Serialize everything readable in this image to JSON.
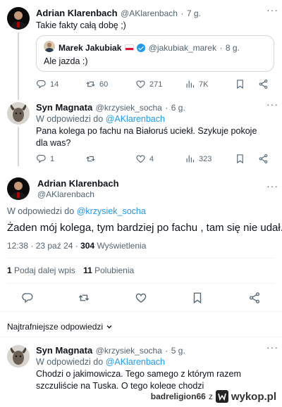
{
  "tweet1": {
    "author_name": "Adrian Klarenbach",
    "author_handle": "@AKlarenbach",
    "separator": "·",
    "time": "7 g.",
    "text": "Takie fakty całą dobę ;)",
    "quote": {
      "author_name": "Marek Jakubiak",
      "author_handle": "@jakubiak_marek",
      "separator": "·",
      "time": "8 g.",
      "text": "Ale jazda :)"
    },
    "metrics": {
      "replies": "14",
      "reposts": "60",
      "likes": "271",
      "views": "7K"
    }
  },
  "tweet2": {
    "author_name": "Syn Magnata",
    "author_handle": "@krzysiek_socha",
    "separator": "·",
    "time": "6 g.",
    "reply_prefix": "W odpowiedzi do",
    "reply_to": "@AKlarenbach",
    "text": "Pana kolega po fachu na Białoruś uciekł. Szykuje pokoje dla was?",
    "metrics": {
      "replies": "1",
      "reposts": "",
      "likes": "4",
      "views": "323"
    }
  },
  "main_tweet": {
    "author_name": "Adrian Klarenbach",
    "author_handle": "@AKlarenbach",
    "reply_prefix": "W odpowiedzi do",
    "reply_to": "@krzysiek_socha",
    "text": "Żaden mój kolega, tym bardziej po fachu , tam się nie udał.",
    "timestamp": "12:38 · 23 paź 24 ·",
    "views_count": "304",
    "views_label": "Wyświetlenia",
    "reposts_count": "1",
    "reposts_label": "Podaj dalej wpis",
    "likes_count": "11",
    "likes_label": "Polubienia"
  },
  "sort": {
    "label": "Najtrafniejsze odpowiedzi"
  },
  "tweet3": {
    "author_name": "Syn Magnata",
    "author_handle": "@krzysiek_socha",
    "separator": "·",
    "time": "5 g.",
    "reply_prefix": "W odpowiedzi do",
    "reply_to": "@AKlarenbach",
    "text": "Chodzi o jakimowicza. Tego samego z którym razem szczuliście na Tuska. O tego kolegę chodzi"
  },
  "watermark": {
    "user": "badreligion66",
    "connector": "z",
    "site": "wykop.pl"
  },
  "icons": {
    "reply": "reply-icon",
    "repost": "repost-icon",
    "like": "heart-icon",
    "views": "views-icon",
    "bookmark": "bookmark-icon",
    "share": "share-icon",
    "more": "more-icon",
    "verified": "verified-icon",
    "flag": "poland-flag-icon",
    "chevron": "chevron-down-icon"
  },
  "colors": {
    "link": "#1d9bf0",
    "muted": "#536471",
    "text": "#0f1419",
    "border": "#cfd9de"
  }
}
